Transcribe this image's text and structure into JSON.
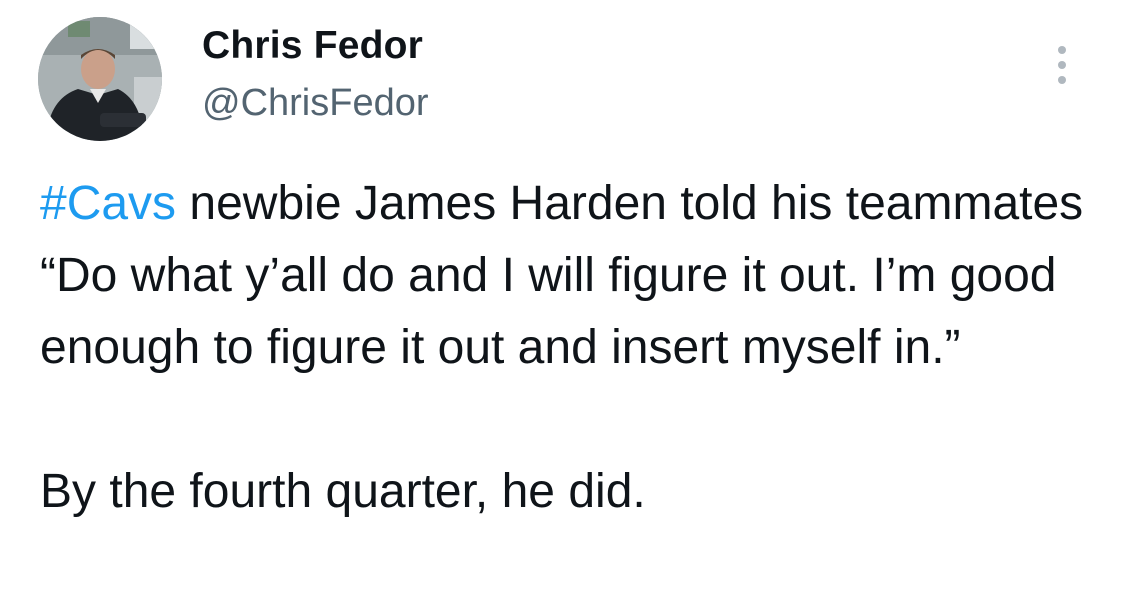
{
  "author": {
    "name": "Chris Fedor",
    "handle": "@ChrisFedor"
  },
  "tweet": {
    "hashtag": "#Cavs",
    "paragraph1_rest": " newbie James Harden told his teammates “Do what y’all do and I will figure it out. I’m good enough to figure it out and insert myself in.”",
    "paragraph2": "By the fourth quarter, he did."
  },
  "icons": {
    "avatar": "profile-photo",
    "more": "more-vertical-icon"
  },
  "colors": {
    "text": "#0f1419",
    "handle": "#536471",
    "hashtag": "#1d9bf0",
    "more_dots": "#b0b8bf"
  }
}
